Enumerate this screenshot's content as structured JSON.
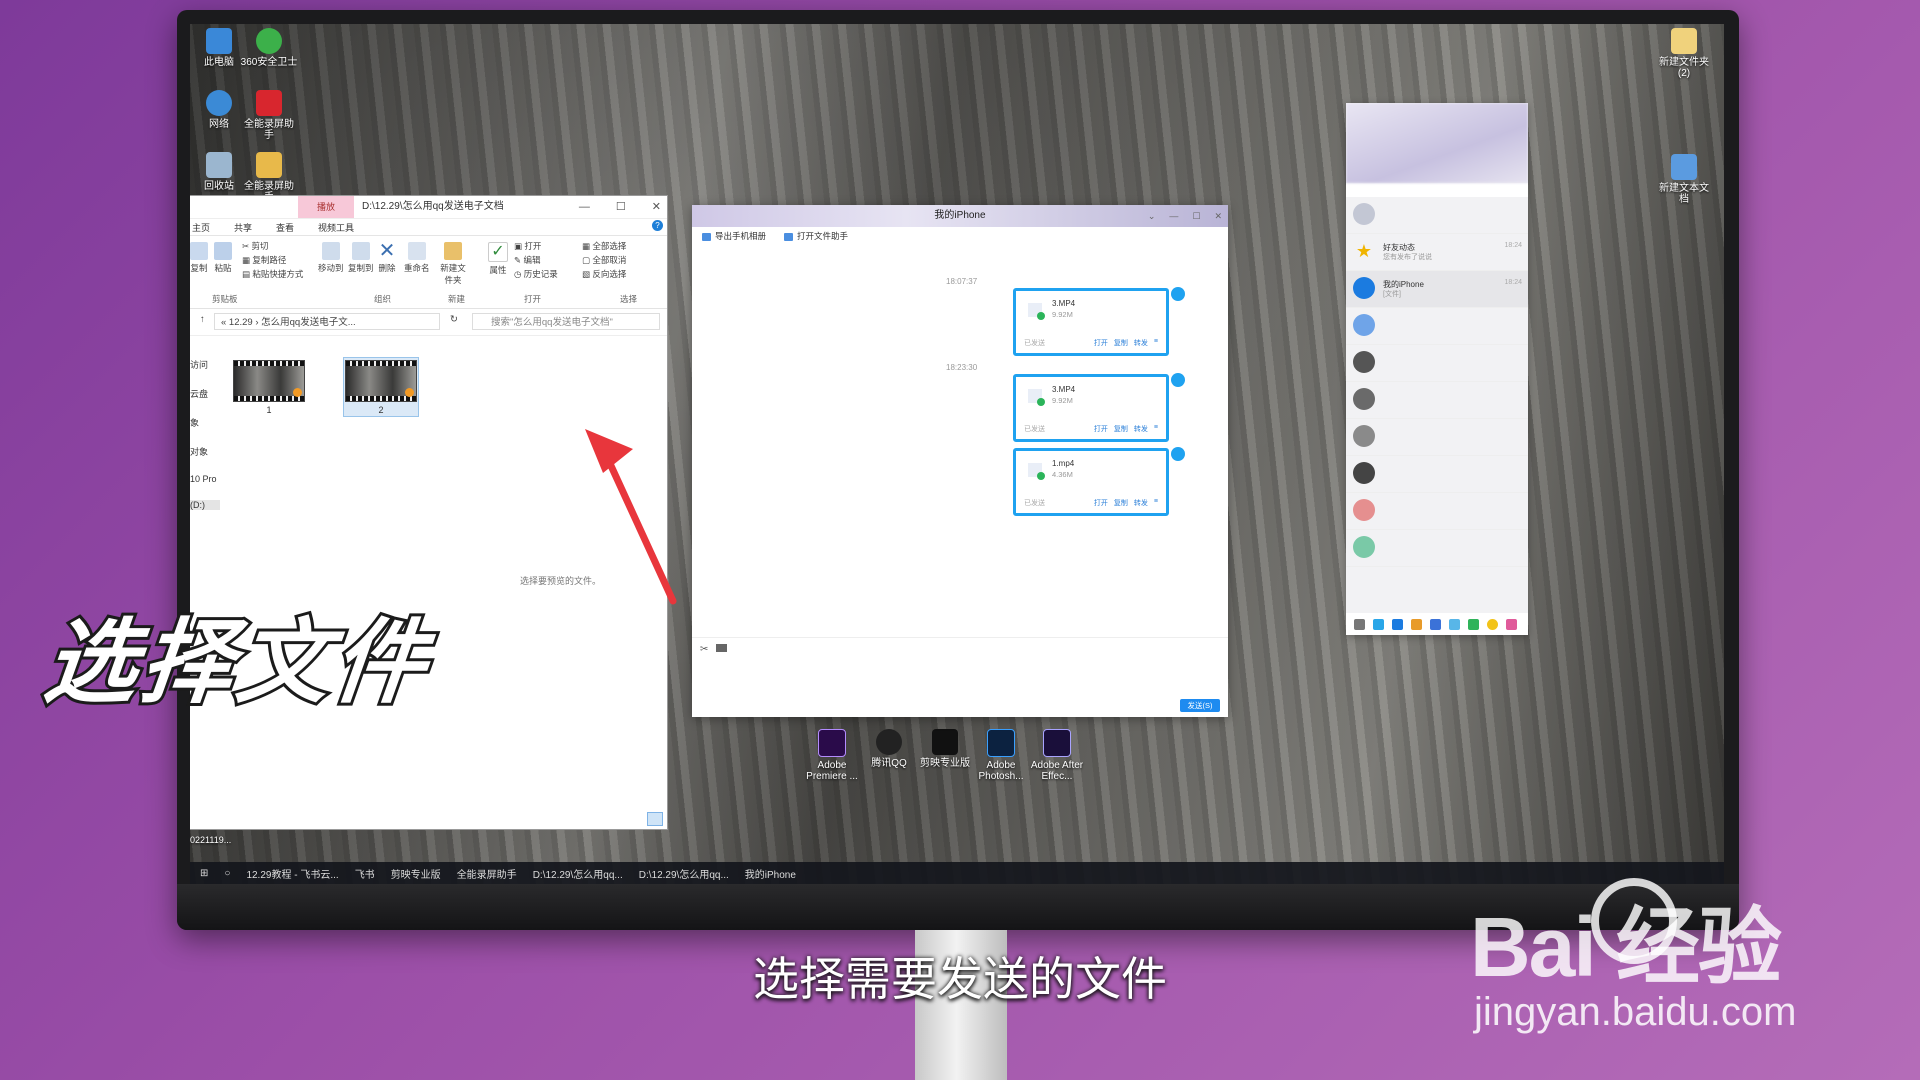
{
  "desktop_icons": [
    {
      "label": "此电脑"
    },
    {
      "label": "360安全卫士"
    },
    {
      "label": "网络"
    },
    {
      "label": "全能录屏助手"
    },
    {
      "label": "回收站"
    },
    {
      "label": "全能录屏助手"
    },
    {
      "label": "新建文件夹 (2)"
    },
    {
      "label": "新建文本文档"
    }
  ],
  "bottom_apps": [
    {
      "label": "Adobe Premiere ..."
    },
    {
      "label": "腾讯QQ"
    },
    {
      "label": "剪映专业版"
    },
    {
      "label": "Adobe Photosh..."
    },
    {
      "label": "Adobe After Effec..."
    }
  ],
  "explorer": {
    "context_tab": "播放",
    "path_title": "D:\\12.29\\怎么用qq发送电子文档",
    "tabs": [
      "主页",
      "共享",
      "查看",
      "视频工具"
    ],
    "ribbon": {
      "cut": "剪切",
      "copy_path": "复制路径",
      "paste_shortcut": "粘贴快捷方式",
      "copy": "复制",
      "paste": "粘贴",
      "move_to": "移动到",
      "copy_to": "复制到",
      "delete": "删除",
      "rename": "重命名",
      "new_folder": "新建文件夹",
      "properties": "属性",
      "open": "打开",
      "edit": "编辑",
      "history": "历史记录",
      "select_all": "全部选择",
      "select_none": "全部取消",
      "invert": "反向选择",
      "groups": [
        "剪贴板",
        "组织",
        "新建",
        "打开",
        "选择"
      ]
    },
    "address": "« 12.29 › 怎么用qq发送电子文...",
    "search_placeholder": "搜索\"怎么用qq发送电子文档\"",
    "nav": [
      "访问",
      "云盘",
      "象",
      "对象",
      "",
      "",
      "",
      "10 Pro",
      "(D:)"
    ],
    "files": [
      {
        "name": "1"
      },
      {
        "name": "2"
      }
    ],
    "preview_msg": "选择要预览的文件。",
    "status_left": "0221119..."
  },
  "chat": {
    "title": "我的iPhone",
    "tools": [
      "导出手机相册",
      "打开文件助手"
    ],
    "timestamps": [
      "18:07:37",
      "18:23:30"
    ],
    "messages": [
      {
        "file": "3.MP4",
        "size": "9.92M",
        "status": "已发送",
        "actions": [
          "打开",
          "复制",
          "转发"
        ]
      },
      {
        "file": "3.MP4",
        "size": "9.92M",
        "status": "已发送",
        "actions": [
          "打开",
          "复制",
          "转发"
        ]
      },
      {
        "file": "1.mp4",
        "size": "4.36M",
        "status": "已发送",
        "actions": [
          "打开",
          "复制",
          "转发"
        ]
      }
    ],
    "send_button": "发送(S)"
  },
  "qq_list": {
    "items": [
      {
        "name": "好友动态",
        "sub": "您有发布了说说",
        "time": "18:24",
        "blur": false
      },
      {
        "name": "我的iPhone",
        "sub": "[文件]",
        "time": "18:24",
        "blur": false
      }
    ]
  },
  "overlay": {
    "title": "选择文件",
    "subtitle": "选择需要发送的文件"
  },
  "watermark": {
    "logo": "Bai  经验",
    "url": "jingyan.baidu.com"
  },
  "taskbar": [
    "12.29教程 - 飞书云...",
    "飞书",
    "剪映专业版",
    "全能录屏助手",
    "D:\\12.29\\怎么用qq...",
    "D:\\12.29\\怎么用qq...",
    "我的iPhone"
  ],
  "colors": {
    "accent": "#1fa2f0",
    "highlight_bg": "#f7c8d8",
    "send": "#1e8bf0"
  }
}
